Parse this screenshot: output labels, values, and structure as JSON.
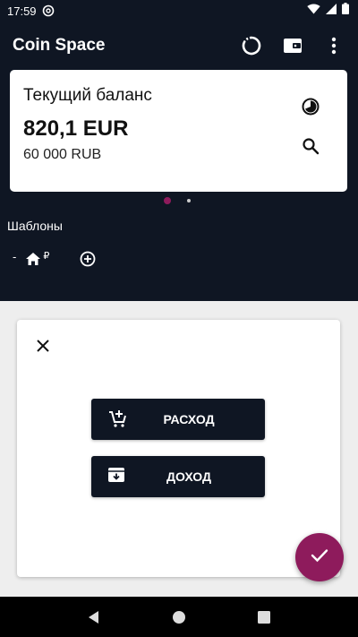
{
  "status_bar": {
    "time": "17:59"
  },
  "app_bar": {
    "title": "Coin Space"
  },
  "balance_card": {
    "label": "Текущий баланс",
    "amount": "820,1 EUR",
    "converted": "60 000 RUB"
  },
  "pager": {
    "pages": 2,
    "active": 1
  },
  "templates": {
    "title": "Шаблоны",
    "item": {
      "prefix": "-",
      "currency": "₽"
    }
  },
  "dialog": {
    "expense_label": "РАСХОД",
    "income_label": "ДОХОД"
  },
  "colors": {
    "background": "#0f1623",
    "accent": "#8e1b5c",
    "sheet": "#eeeeee",
    "card": "#ffffff"
  },
  "icons": {
    "status": [
      "at-sign-icon",
      "wifi-icon",
      "signal-icon",
      "battery-icon"
    ],
    "app_bar": [
      "sync-icon",
      "wallet-icon",
      "more-vert-icon"
    ],
    "card": [
      "pie-chart-icon",
      "search-icon"
    ],
    "templates": [
      "home-icon",
      "add-circle-icon"
    ],
    "dialog": [
      "close-icon",
      "cart-add-icon",
      "archive-icon"
    ],
    "fab": "check-icon",
    "nav": [
      "back-icon",
      "home-circle-icon",
      "recents-icon"
    ]
  }
}
